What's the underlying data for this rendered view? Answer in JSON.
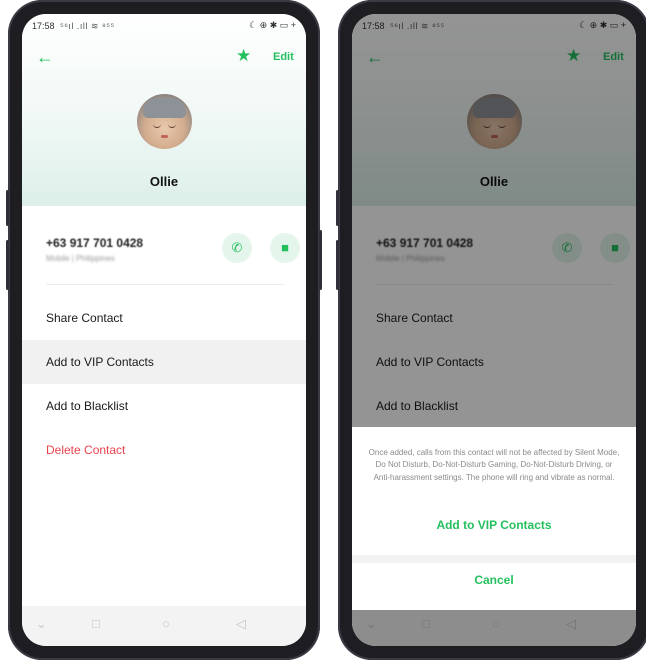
{
  "status_bar": {
    "time": "17:58",
    "signal": "⁵⁶ıl .ıll ≋ ⁸⁵⁵",
    "right": "☾ ⊕ ✱ ▭ +"
  },
  "header": {
    "edit_label": "Edit"
  },
  "contact": {
    "name": "Ollie",
    "phone": "+63 917 701 0428",
    "phone_type": "Mobile | Philippines"
  },
  "menu": {
    "share": "Share Contact",
    "vip": "Add to VIP Contacts",
    "blacklist": "Add to Blacklist",
    "delete": "Delete Contact"
  },
  "vip_sheet": {
    "description": "Once added, calls from this contact will not be affected by Silent Mode, Do Not Disturb, Do-Not-Disturb Gaming, Do-Not-Disturb Driving, or Anti-harassment settings. The phone will ring and vibrate as normal.",
    "confirm_label": "Add to VIP Contacts",
    "cancel_label": "Cancel"
  },
  "icons": {
    "back": "arrow-left-icon",
    "star": "star-icon",
    "call": "phone-icon",
    "message": "message-icon",
    "nav_back": "triangle-back-icon",
    "nav_home": "circle-home-icon",
    "nav_recents": "square-recents-icon"
  },
  "colors": {
    "accent": "#25c05e",
    "danger": "#e8434f",
    "highlight": "#f1f1f1"
  }
}
